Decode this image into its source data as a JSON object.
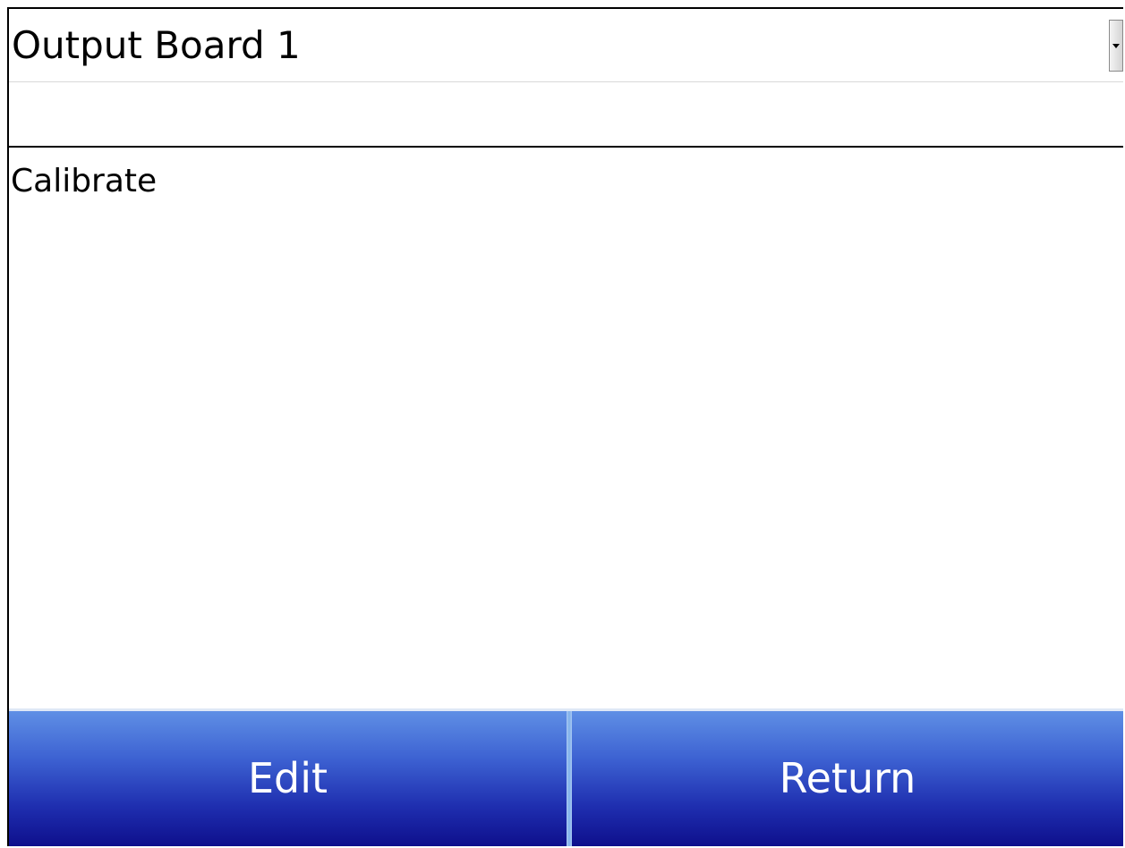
{
  "dropdown": {
    "selected_value": "Output Board 1",
    "arrow_icon": "chevron-down-icon"
  },
  "list": {
    "items": [
      "Calibrate"
    ]
  },
  "buttons": {
    "edit_label": "Edit",
    "return_label": "Return"
  },
  "colors": {
    "button_gradient_top": "#5f8fe5",
    "button_gradient_bottom": "#0e0f8c",
    "button_text": "#ffffff",
    "divider": "#7fb0ea"
  }
}
